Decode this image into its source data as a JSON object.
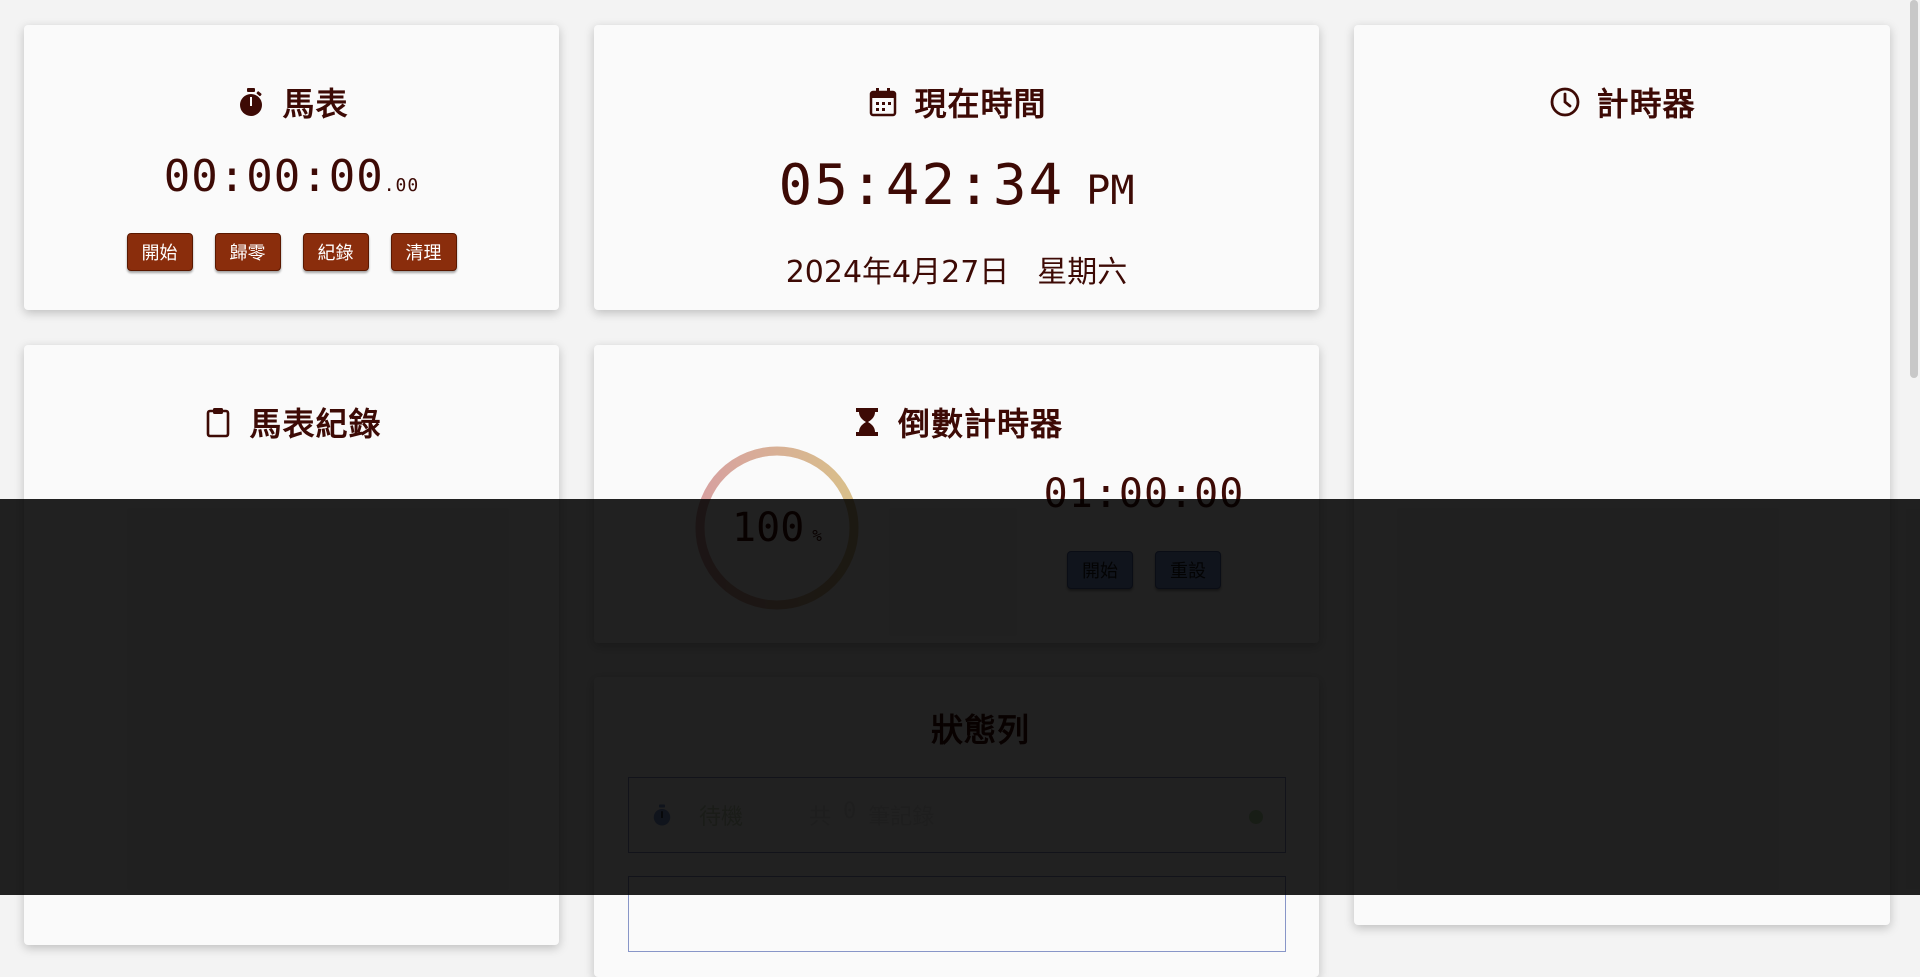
{
  "stopwatch": {
    "title": "馬表",
    "time": "00:00:00",
    "ms": ".00",
    "buttons": {
      "start": "開始",
      "reset": "歸零",
      "record": "紀錄",
      "clear": "清理"
    }
  },
  "clock": {
    "title": "現在時間",
    "time": "05:42:34",
    "ampm": "PM",
    "date": "2024年4月27日",
    "weekday": "星期六"
  },
  "timer": {
    "title": "計時器"
  },
  "records": {
    "title": "馬表紀錄"
  },
  "countdown": {
    "title": "倒數計時器",
    "percent": "100",
    "percent_sign": "%",
    "progress": 1.0,
    "time": "01:00:00",
    "buttons": {
      "start": "開始",
      "reset": "重設"
    }
  },
  "status": {
    "title": "狀態列",
    "row": {
      "state": "待機",
      "count_prefix": "共",
      "count": "0",
      "count_suffix": "筆記錄"
    }
  },
  "colors": {
    "text": "#3d0a05",
    "button": "#8a2d0c",
    "button_blue": "#7c97d6",
    "ring_start": "#d7a0a0",
    "ring_end": "#d9c08a",
    "status_dot": "#b7dca8"
  },
  "icons": {
    "stopwatch": "stopwatch-icon",
    "calendar": "calendar-icon",
    "clock": "clock-icon",
    "clipboard": "clipboard-icon",
    "hourglass": "hourglass-icon",
    "signal": "signal-icon"
  }
}
